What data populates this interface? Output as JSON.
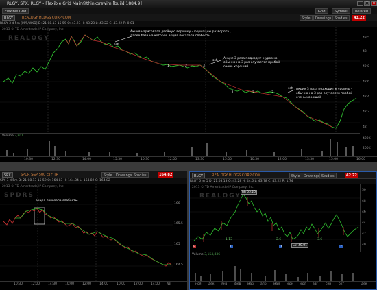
{
  "window": {
    "title": "RLGY, SPX, RLGY - Flexible Grid Main@thinkorswim [build 1884.9]"
  },
  "toolbar": {
    "left_label": "Flexible Grid",
    "right_buttons": [
      "Grid",
      "Symbol",
      "Related"
    ]
  },
  "top_panel": {
    "symbol": "RLGY",
    "news": "REALOGY HLDGS CORP COM",
    "buttons": [
      "Style",
      "Drawings",
      "Studies"
    ],
    "price": "43.22",
    "quote_bar": "RLGY 3 d 5m [M/S/WKD]   D: 21.08.13 15:59   O: 43.23   H: 43.23   L: 43.22   C: 43.22   R: 0.01",
    "copyright": "2013 © TD Ameritrade IP Company, Inc.",
    "watermark": "REALOGY",
    "annotations": {
      "a1": "Акция нарисовала двойную вершину - формацию разворота , далее база на которой акция показала слабость",
      "a2": "Акция 3 раза подходит к уровню - обычно на 3 раз случается пробой - очень хороший .",
      "a3": "Акция 3 раза подходит к уровню - обычно на 3 раз случается пробой - очень хороший"
    },
    "level_counts": [
      "1",
      "2",
      "3",
      "1",
      "2",
      "3"
    ],
    "ssh_labels": [
      "ssh",
      "ssh",
      "ssh"
    ],
    "y_ticks": [
      "43.5",
      "43",
      "42.8",
      "42.6",
      "42.4",
      "42.2",
      "42"
    ],
    "volume_label": "Volume",
    "volume_value": "3,801",
    "volume_ticks": [
      "400K",
      "200K"
    ],
    "x_ticks": [
      "10:30",
      "12:30",
      "14:00",
      "15:30",
      "10:30",
      "12:00",
      "13:30",
      "15:00",
      "10:30",
      "12:00",
      "13:30",
      "15:00",
      "16:00"
    ]
  },
  "bottom_left": {
    "symbol": "SPX",
    "news": "SPDR S&P 500 ETF TR",
    "buttons": [
      "Style",
      "Drawings",
      "Studies"
    ],
    "price": "164.82",
    "quote_bar": "SPY 3 d 5m   D: 21.08.13 15:59   O: 164.83   H: 164.84   L: 164.82   C: 164.82",
    "copyright": "2013 © TD Ameritrade IP Company, Inc.",
    "watermark": "SPDRS",
    "annotation": "акция показала слабость.",
    "y_ticks": [
      "166",
      "165.5",
      "165",
      "164.5"
    ],
    "x_ticks": [
      "10:30",
      "12:00",
      "14:30",
      "10:00",
      "12:00",
      "14:00",
      "10:00",
      "12:00",
      "14:00",
      "Wi"
    ]
  },
  "bottom_right": {
    "symbol": "RLGY",
    "news": "REALOGY HLDGS CORP COM",
    "buttons": [
      "Style",
      "Drawings",
      "Studies"
    ],
    "price": "42.22",
    "quote_bar": "RLGY 6 m D   D: 21.08.13   O: 43.28   H: 44.6   L: 43.78   C: 43.22   R: 1.74",
    "copyright": "2013 © TD Ameritrade IP Company, Inc.",
    "watermark": "REALOGY",
    "hh_label": "hh 55.20",
    "lo_label": "Lo: 40.01",
    "small_labels": [
      "1.13",
      "2.6",
      "3.6"
    ],
    "y_ticks": [
      "50",
      "48",
      "46",
      "44",
      "42",
      "40"
    ],
    "volume_label": "Volume",
    "volume_value": "3,154,836",
    "x_ticks": [
      "ноя",
      "дек",
      "янв",
      "фев",
      "мар",
      "апр",
      "май",
      "июн",
      "июл",
      "авг",
      "сен",
      "окт",
      "дек"
    ]
  }
}
